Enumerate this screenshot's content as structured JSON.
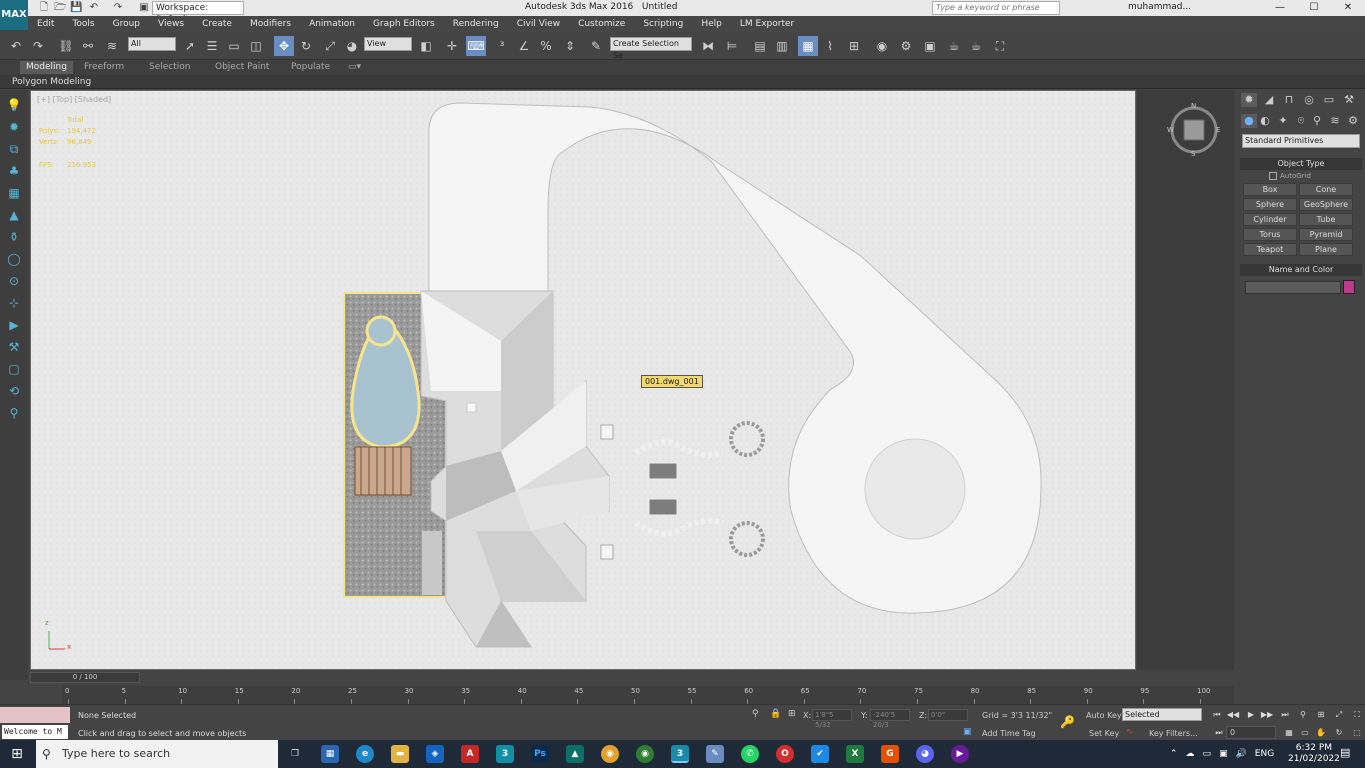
{
  "titlebar": {
    "logo": "MAX",
    "workspace": "Workspace: Default",
    "app_title": "Autodesk 3ds Max 2016",
    "doc_title": "Untitled",
    "search_placeholder": "Type a keyword or phrase",
    "user": "muhammad...",
    "minimize": "—",
    "maximize": "☐",
    "close": "✕"
  },
  "menu": [
    "Edit",
    "Tools",
    "Group",
    "Views",
    "Create",
    "Modifiers",
    "Animation",
    "Graph Editors",
    "Rendering",
    "Civil View",
    "Customize",
    "Scripting",
    "Help",
    "LM Exporter"
  ],
  "toolbar": {
    "filter": "All",
    "ref_coord": "View",
    "selection_set": "Create Selection Se"
  },
  "ribbon": {
    "tabs": [
      "Modeling",
      "Freeform",
      "Selection",
      "Object Paint",
      "Populate"
    ],
    "subtitle": "Polygon Modeling"
  },
  "viewport": {
    "label": "[+] [Top] [Shaded]",
    "stats": {
      "header": "Total",
      "polys_label": "Polys:",
      "polys": "194,472",
      "verts_label": "Verts:",
      "verts": "96,849",
      "fps_label": "FPS:",
      "fps": "216.953"
    },
    "object_tag": "001.dwg_001",
    "compass": {
      "n": "N",
      "s": "S",
      "e": "E",
      "w": "W"
    },
    "axis_x": "x",
    "axis_z": "z"
  },
  "command_panel": {
    "category": "Standard Primitives",
    "object_type_title": "Object Type",
    "autogrid": "AutoGrid",
    "primitives": [
      "Box",
      "Cone",
      "Sphere",
      "GeoSphere",
      "Cylinder",
      "Tube",
      "Torus",
      "Pyramid",
      "Teapot",
      "Plane"
    ],
    "name_color_title": "Name and Color",
    "object_color": "#c13a8a"
  },
  "timeline": {
    "slider": "0 / 100",
    "ticks": [
      "0",
      "5",
      "10",
      "15",
      "20",
      "25",
      "30",
      "35",
      "40",
      "45",
      "50",
      "55",
      "60",
      "65",
      "70",
      "75",
      "80",
      "85",
      "90",
      "95",
      "100"
    ]
  },
  "status": {
    "welcome": "Welcome to M",
    "selection": "None Selected",
    "prompt": "Click and drag to select and move objects",
    "x_label": "X:",
    "x_val": "1'8\"5 5/32",
    "y_label": "Y:",
    "y_val": "-240'5 20/3",
    "z_label": "Z:",
    "z_val": "0'0\"",
    "grid": "Grid = 3'3 11/32\"",
    "add_time_tag": "Add Time Tag",
    "auto_key": "Auto Key",
    "set_key": "Set Key",
    "key_mode": "Selected",
    "key_filters": "Key Filters...",
    "frame": "0"
  },
  "taskbar": {
    "search": "Type here to search",
    "language": "ENG",
    "time": "6:32 PM",
    "date": "21/02/2022"
  }
}
